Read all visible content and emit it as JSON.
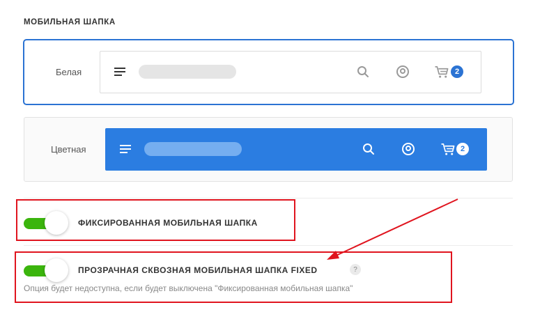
{
  "section": {
    "title": "МОБИЛЬНАЯ ШАПКА"
  },
  "header_options": [
    {
      "label": "Белая",
      "selected": true,
      "cart_count": "2",
      "style": "white",
      "accent": "#2b73d3"
    },
    {
      "label": "Цветная",
      "selected": false,
      "cart_count": "2",
      "style": "colored",
      "accent": "#2b7de1"
    }
  ],
  "settings": {
    "fixed": {
      "label": "ФИКСИРОВАННАЯ МОБИЛЬНАЯ ШАПКА",
      "enabled": true
    },
    "transparent": {
      "label": "ПРОЗРАЧНАЯ СКВОЗНАЯ МОБИЛЬНАЯ ШАПКА FIXED",
      "enabled": true,
      "help": "?",
      "hint": "Опция будет недоступна, если будет выключена \"Фиксированная мобильная шапка\""
    }
  },
  "colors": {
    "toggle_on": "#3bb50d",
    "highlight": "#e0141e",
    "selected_border": "#2b73d3"
  },
  "icons": [
    "menu-icon",
    "search-icon",
    "user-icon",
    "cart-icon"
  ]
}
